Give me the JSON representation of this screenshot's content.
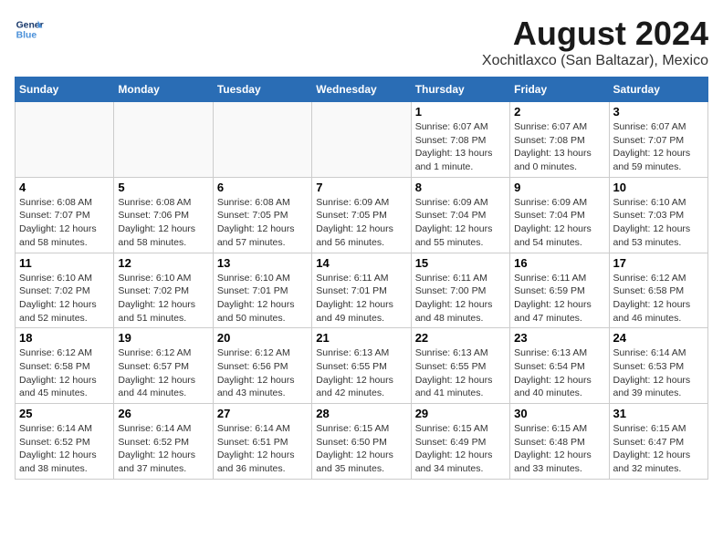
{
  "header": {
    "logo_line1": "General",
    "logo_line2": "Blue",
    "month": "August 2024",
    "location": "Xochitlaxco (San Baltazar), Mexico"
  },
  "weekdays": [
    "Sunday",
    "Monday",
    "Tuesday",
    "Wednesday",
    "Thursday",
    "Friday",
    "Saturday"
  ],
  "weeks": [
    [
      {
        "day": "",
        "info": ""
      },
      {
        "day": "",
        "info": ""
      },
      {
        "day": "",
        "info": ""
      },
      {
        "day": "",
        "info": ""
      },
      {
        "day": "1",
        "info": "Sunrise: 6:07 AM\nSunset: 7:08 PM\nDaylight: 13 hours\nand 1 minute."
      },
      {
        "day": "2",
        "info": "Sunrise: 6:07 AM\nSunset: 7:08 PM\nDaylight: 13 hours\nand 0 minutes."
      },
      {
        "day": "3",
        "info": "Sunrise: 6:07 AM\nSunset: 7:07 PM\nDaylight: 12 hours\nand 59 minutes."
      }
    ],
    [
      {
        "day": "4",
        "info": "Sunrise: 6:08 AM\nSunset: 7:07 PM\nDaylight: 12 hours\nand 58 minutes."
      },
      {
        "day": "5",
        "info": "Sunrise: 6:08 AM\nSunset: 7:06 PM\nDaylight: 12 hours\nand 58 minutes."
      },
      {
        "day": "6",
        "info": "Sunrise: 6:08 AM\nSunset: 7:05 PM\nDaylight: 12 hours\nand 57 minutes."
      },
      {
        "day": "7",
        "info": "Sunrise: 6:09 AM\nSunset: 7:05 PM\nDaylight: 12 hours\nand 56 minutes."
      },
      {
        "day": "8",
        "info": "Sunrise: 6:09 AM\nSunset: 7:04 PM\nDaylight: 12 hours\nand 55 minutes."
      },
      {
        "day": "9",
        "info": "Sunrise: 6:09 AM\nSunset: 7:04 PM\nDaylight: 12 hours\nand 54 minutes."
      },
      {
        "day": "10",
        "info": "Sunrise: 6:10 AM\nSunset: 7:03 PM\nDaylight: 12 hours\nand 53 minutes."
      }
    ],
    [
      {
        "day": "11",
        "info": "Sunrise: 6:10 AM\nSunset: 7:02 PM\nDaylight: 12 hours\nand 52 minutes."
      },
      {
        "day": "12",
        "info": "Sunrise: 6:10 AM\nSunset: 7:02 PM\nDaylight: 12 hours\nand 51 minutes."
      },
      {
        "day": "13",
        "info": "Sunrise: 6:10 AM\nSunset: 7:01 PM\nDaylight: 12 hours\nand 50 minutes."
      },
      {
        "day": "14",
        "info": "Sunrise: 6:11 AM\nSunset: 7:01 PM\nDaylight: 12 hours\nand 49 minutes."
      },
      {
        "day": "15",
        "info": "Sunrise: 6:11 AM\nSunset: 7:00 PM\nDaylight: 12 hours\nand 48 minutes."
      },
      {
        "day": "16",
        "info": "Sunrise: 6:11 AM\nSunset: 6:59 PM\nDaylight: 12 hours\nand 47 minutes."
      },
      {
        "day": "17",
        "info": "Sunrise: 6:12 AM\nSunset: 6:58 PM\nDaylight: 12 hours\nand 46 minutes."
      }
    ],
    [
      {
        "day": "18",
        "info": "Sunrise: 6:12 AM\nSunset: 6:58 PM\nDaylight: 12 hours\nand 45 minutes."
      },
      {
        "day": "19",
        "info": "Sunrise: 6:12 AM\nSunset: 6:57 PM\nDaylight: 12 hours\nand 44 minutes."
      },
      {
        "day": "20",
        "info": "Sunrise: 6:12 AM\nSunset: 6:56 PM\nDaylight: 12 hours\nand 43 minutes."
      },
      {
        "day": "21",
        "info": "Sunrise: 6:13 AM\nSunset: 6:55 PM\nDaylight: 12 hours\nand 42 minutes."
      },
      {
        "day": "22",
        "info": "Sunrise: 6:13 AM\nSunset: 6:55 PM\nDaylight: 12 hours\nand 41 minutes."
      },
      {
        "day": "23",
        "info": "Sunrise: 6:13 AM\nSunset: 6:54 PM\nDaylight: 12 hours\nand 40 minutes."
      },
      {
        "day": "24",
        "info": "Sunrise: 6:14 AM\nSunset: 6:53 PM\nDaylight: 12 hours\nand 39 minutes."
      }
    ],
    [
      {
        "day": "25",
        "info": "Sunrise: 6:14 AM\nSunset: 6:52 PM\nDaylight: 12 hours\nand 38 minutes."
      },
      {
        "day": "26",
        "info": "Sunrise: 6:14 AM\nSunset: 6:52 PM\nDaylight: 12 hours\nand 37 minutes."
      },
      {
        "day": "27",
        "info": "Sunrise: 6:14 AM\nSunset: 6:51 PM\nDaylight: 12 hours\nand 36 minutes."
      },
      {
        "day": "28",
        "info": "Sunrise: 6:15 AM\nSunset: 6:50 PM\nDaylight: 12 hours\nand 35 minutes."
      },
      {
        "day": "29",
        "info": "Sunrise: 6:15 AM\nSunset: 6:49 PM\nDaylight: 12 hours\nand 34 minutes."
      },
      {
        "day": "30",
        "info": "Sunrise: 6:15 AM\nSunset: 6:48 PM\nDaylight: 12 hours\nand 33 minutes."
      },
      {
        "day": "31",
        "info": "Sunrise: 6:15 AM\nSunset: 6:47 PM\nDaylight: 12 hours\nand 32 minutes."
      }
    ]
  ]
}
